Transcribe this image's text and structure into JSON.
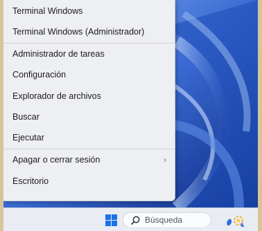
{
  "context_menu": {
    "items": [
      {
        "label": "Terminal Windows"
      },
      {
        "label": "Terminal Windows (Administrador)"
      },
      {
        "label": "Administrador de tareas"
      },
      {
        "label": "Configuración"
      },
      {
        "label": "Explorador de archivos"
      },
      {
        "label": "Buscar"
      },
      {
        "label": "Ejecutar"
      },
      {
        "label": "Apagar o cerrar sesión",
        "chevron": "›"
      },
      {
        "label": "Escritorio"
      }
    ]
  },
  "taskbar": {
    "start_icon": "windows-logo-icon",
    "search": {
      "label": "Búsqueda",
      "icon": "search-icon"
    },
    "widget_icon": "weather-widget-icon"
  },
  "colors": {
    "windows_blue": "#1a73e8",
    "menu_background": "#eeeff3",
    "outer_border": "#d9c49a"
  }
}
